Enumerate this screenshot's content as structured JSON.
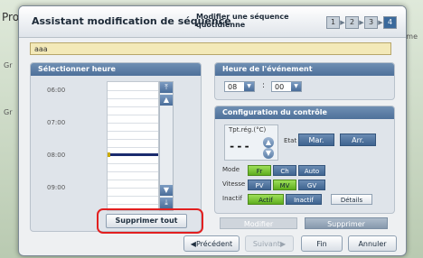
{
  "background": {
    "title_fragment": "Pro",
    "side_labels": [
      "Gr",
      "Gr"
    ],
    "right_label": "me"
  },
  "dialog": {
    "title": "Assistant modification de séquence",
    "subtitle": "Modifier une séquence quotidienne",
    "steps": [
      "1",
      "2",
      "3",
      "4"
    ],
    "active_step": 4,
    "name_value": "aaa"
  },
  "left_panel": {
    "header": "Sélectionner heure",
    "time_labels": [
      "06:00",
      "07:00",
      "08:00",
      "09:00"
    ],
    "delete_all": "Supprimer tout",
    "selected_time": "08:00"
  },
  "event_time": {
    "header": "Heure de l'événement",
    "hour": "08",
    "minute": "00",
    "separator": ":"
  },
  "control": {
    "header": "Configuration du contrôle",
    "setpoint_label": "Tpt.rég.(°C)",
    "setpoint_value": "---",
    "state_label": "Etat",
    "state_on": "Mar.",
    "state_off": "Arr.",
    "mode_label": "Mode",
    "mode_options": [
      "Fr",
      "Ch",
      "Auto"
    ],
    "mode_selected": "Fr",
    "speed_label": "Vitesse",
    "speed_options": [
      "PV",
      "MV",
      "GV"
    ],
    "speed_selected": "MV",
    "inactive_label": "Inactif",
    "inactive_options": [
      "Actif",
      "Inactif"
    ],
    "inactive_selected": "Actif",
    "details": "Détails",
    "modify": "Modifier",
    "delete": "Supprimer"
  },
  "footer": {
    "previous": "◀Précédent",
    "next": "Suivant▶",
    "finish": "Fin",
    "cancel": "Annuler"
  },
  "colors": {
    "accent_blue": "#3f6490",
    "selected_green": "#5fae1e",
    "highlight_red": "#e22020",
    "name_field": "#f3e9b8"
  }
}
